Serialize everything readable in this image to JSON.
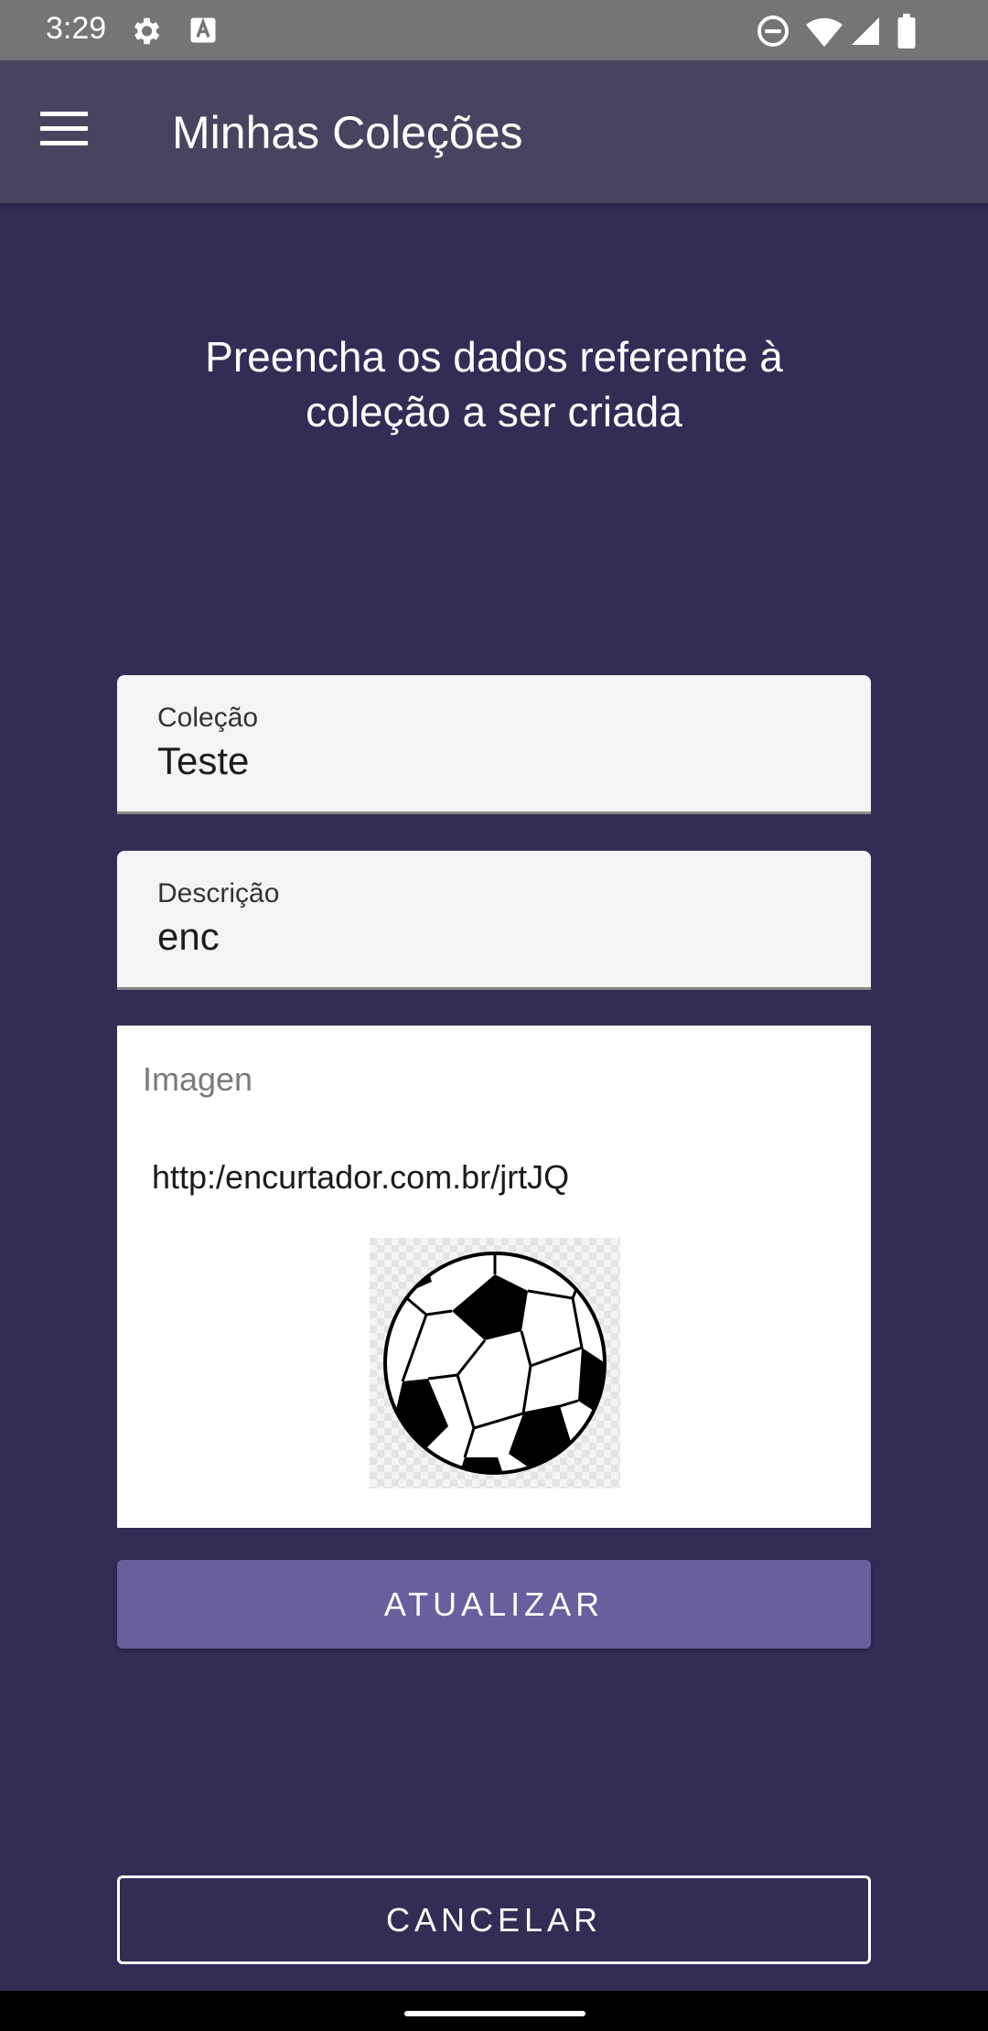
{
  "status_bar": {
    "time": "3:29",
    "icons": [
      "settings-icon",
      "keyboard-icon",
      "do-not-disturb-icon",
      "wifi-icon",
      "signal-icon",
      "battery-icon"
    ]
  },
  "app_bar": {
    "title": "Minhas Coleções",
    "menu_icon": "menu-icon"
  },
  "form": {
    "heading": "Preencha os dados referente à coleção a ser criada",
    "colecao": {
      "label": "Coleção",
      "value": "Teste"
    },
    "descricao": {
      "label": "Descrição",
      "value": "enc"
    },
    "imagem": {
      "label": "Imagen",
      "url": "http:/encurtador.com.br/jrtJQ",
      "preview": "soccer-ball-image"
    }
  },
  "buttons": {
    "update": "ATUALIZAR",
    "cancel": "CANCELAR"
  },
  "colors": {
    "background": "#332d55",
    "app_bar": "#48445f",
    "primary_button": "#675f9e",
    "status_bar": "#757575"
  }
}
